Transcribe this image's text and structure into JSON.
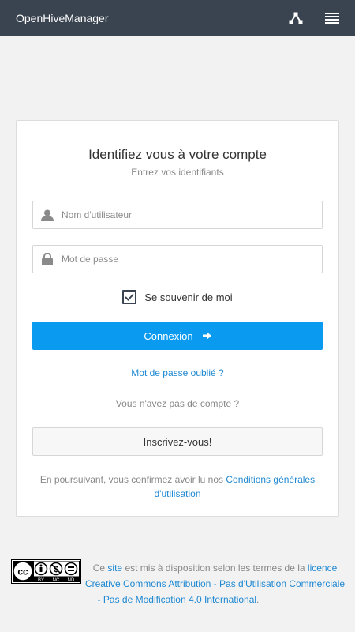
{
  "app": {
    "title": "OpenHiveManager"
  },
  "header": {
    "icons": [
      "network-icon",
      "menu-icon"
    ]
  },
  "login": {
    "title": "Identifiez vous à votre compte",
    "subtitle": "Entrez vos identifiants",
    "username_placeholder": "Nom d'utilisateur",
    "username_value": "",
    "password_placeholder": "Mot de passe",
    "password_value": "",
    "remember_label": "Se souvenir de moi",
    "remember_checked": true,
    "submit_label": "Connexion",
    "forgot_label": "Mot de passe oublié ?",
    "no_account_label": "Vous n'avez pas de compte ?",
    "register_label": "Inscrivez-vous!",
    "terms_text": "En poursuivant, vous confirmez avoir lu nos",
    "terms_link": "Conditions générales d'utilisation"
  },
  "footer": {
    "badge_labels": [
      "BY",
      "NC",
      "ND"
    ],
    "text1": "Ce",
    "site_link": "site",
    "text2": "est mis à disposition selon les termes de la",
    "licence_link": "licence Creative Commons Attribution - Pas d'Utilisation Commerciale - Pas de Modification 4.0 International",
    "text3": "."
  },
  "colors": {
    "header_bg": "#3a4450",
    "primary": "#0a9bf0",
    "link": "#1e88d2"
  }
}
